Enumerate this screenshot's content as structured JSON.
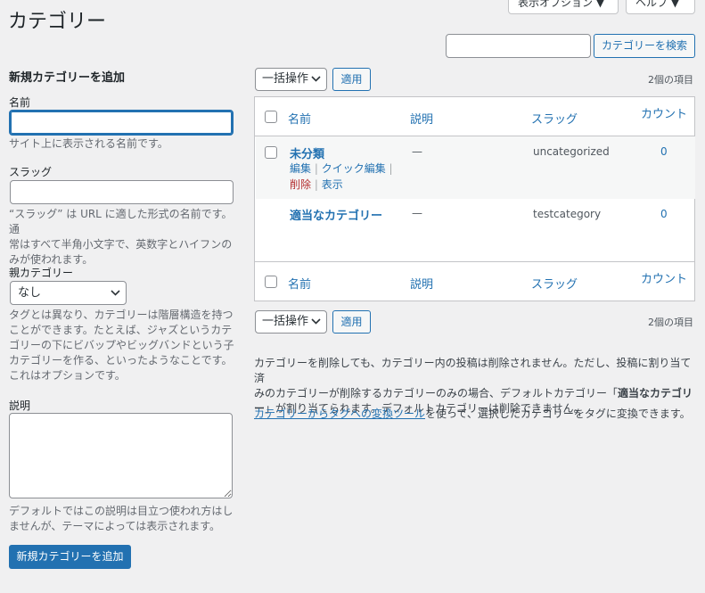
{
  "top_buttons": {
    "screen_options": "表示オプション ▼",
    "help": "ヘルプ ▼"
  },
  "page_title": "カテゴリー",
  "search": {
    "placeholder": "",
    "button": "カテゴリーを検索"
  },
  "add_form": {
    "title": "新規カテゴリーを追加",
    "name_label": "名前",
    "name_help": "サイト上に表示される名前です。",
    "slug_label": "スラッグ",
    "slug_help_1": "“スラッグ” は URL に適した形式の名前です。通",
    "slug_help_2": "常はすべて半角小文字で、英数字とハイフンの",
    "slug_help_3": "みが使われます。",
    "parent_label": "親カテゴリー",
    "parent_value": "なし",
    "parent_help_1": "タグとは異なり、カテゴリーは階層構造を持つ",
    "parent_help_2": "ことができます。たとえば、ジャズというカテ",
    "parent_help_3": "ゴリーの下にビバップやビッグバンドという子",
    "parent_help_4": "カテゴリーを作る、といったようなことです。",
    "parent_help_5": "これはオプションです。",
    "desc_label": "説明",
    "desc_help_1": "デフォルトではこの説明は目立つ使われ方はし",
    "desc_help_2": "ませんが、テーマによっては表示されます。",
    "submit": "新規カテゴリーを追加"
  },
  "bulk": {
    "action": "一括操作",
    "apply": "適用",
    "item_count": "2個の項目"
  },
  "table": {
    "headers": {
      "name": "名前",
      "description": "説明",
      "slug": "スラッグ",
      "count": "カウント"
    },
    "rows": [
      {
        "name": "未分類",
        "description": "—",
        "slug": "uncategorized",
        "count": "0",
        "actions": {
          "edit": "編集",
          "quick_edit": "クイック編集",
          "delete": "削除",
          "view": "表示"
        }
      },
      {
        "name": "適当なカテゴリー",
        "description": "—",
        "slug": "testcategory",
        "count": "0"
      }
    ]
  },
  "notes": {
    "line1": "カテゴリーを削除しても、カテゴリー内の投稿は削除されません。ただし、投稿に割り当て済",
    "line2": "みのカテゴリーが削除するカテゴリーのみの場合、デフォルトカテゴリー「",
    "line2_bold": "適当なカテゴリ",
    "line3_bold": "ー",
    "line3": "」が割り当てられます。デフォルトカテゴリーは削除できません。",
    "link": "カテゴリーからタグへの変換ツール",
    "line4": "を使って、選択したカテゴリーをタグに変換できます。"
  },
  "colors": {
    "accent": "#2271b1",
    "background": "#f0f0f1",
    "delete": "#b32d2e"
  }
}
